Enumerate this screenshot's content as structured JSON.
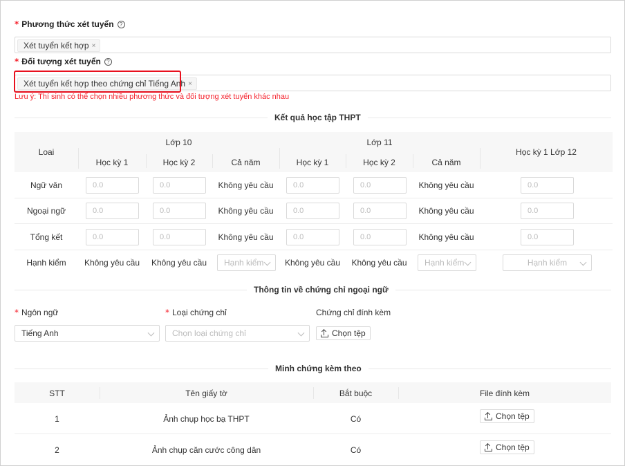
{
  "form": {
    "method": {
      "label": "Phương thức xét tuyển",
      "tag": "Xét tuyển kết hợp",
      "close": "×"
    },
    "target": {
      "label": "Đối tượng xét tuyển",
      "tag": "Xét tuyển kết hợp theo chứng chỉ Tiếng Anh",
      "close": "×"
    },
    "required_mark": "*",
    "help_icon": "?",
    "note": "Lưu ý: Thí sinh có thể chọn nhiều phương thức và đối tượng xét tuyển khác nhau"
  },
  "grades": {
    "title": "Kết quả học tập THPT",
    "headers": {
      "loai": "Loai",
      "lop10": "Lớp 10",
      "lop11": "Lớp 11",
      "hk1": "Học kỳ 1",
      "hk2": "Học kỳ 2",
      "canam": "Cả năm",
      "hk1_12": "Học kỳ 1 Lớp 12"
    },
    "rows": [
      {
        "label": "Ngữ văn",
        "canam10": "Không yêu cầu",
        "canam11": "Không yêu cầu"
      },
      {
        "label": "Ngoại ngữ",
        "canam10": "Không yêu cầu",
        "canam11": "Không yêu cầu"
      },
      {
        "label": "Tổng kết",
        "canam10": "Không yêu cầu",
        "canam11": "Không yêu cầu"
      }
    ],
    "input_placeholder": "0.0",
    "conduct": {
      "label": "Hạnh kiểm",
      "hk1_10": "Không yêu cầu",
      "hk2_10": "Không yêu cầu",
      "canam10": "Hạnh kiểm",
      "hk1_11": "Không yêu cầu",
      "hk2_11": "Không yêu cầu",
      "canam11": "Hạnh kiểm",
      "hk1_12": "Hạnh kiểm"
    }
  },
  "cert": {
    "title": "Thông tin về chứng chỉ ngoại ngữ",
    "language_label": "Ngôn ngữ",
    "language_value": "Tiếng Anh",
    "type_label": "Loại chứng chỉ",
    "type_placeholder": "Chọn loại chứng chỉ",
    "attach_label": "Chứng chỉ đính kèm",
    "upload_label": "Chọn tệp"
  },
  "evidence": {
    "title": "Minh chứng kèm theo",
    "headers": {
      "stt": "STT",
      "name": "Tên giấy tờ",
      "required": "Bắt buộc",
      "file": "File đính kèm"
    },
    "rows": [
      {
        "stt": "1",
        "name": "Ảnh chụp học bạ THPT",
        "required": "Có",
        "upload": "Chọn tệp"
      },
      {
        "stt": "2",
        "name": "Ảnh chụp căn cước công dân",
        "required": "Có",
        "upload": "Chọn tệp"
      }
    ]
  }
}
